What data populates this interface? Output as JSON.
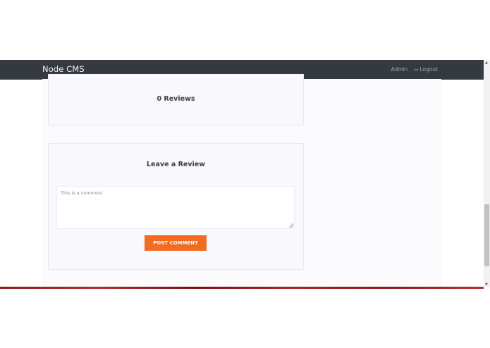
{
  "navbar": {
    "brand": "Node CMS",
    "links": {
      "admin": "Admin",
      "logout": "Logout"
    }
  },
  "reviews": {
    "title": "0 Reviews"
  },
  "leave_review": {
    "title": "Leave a Review",
    "comment_value": "This is a comment",
    "submit_label": "POST COMMENT"
  },
  "colors": {
    "navbar": "#343a40",
    "accent": "#f46a1f"
  },
  "icons": {
    "logout": "sign-out-icon"
  }
}
